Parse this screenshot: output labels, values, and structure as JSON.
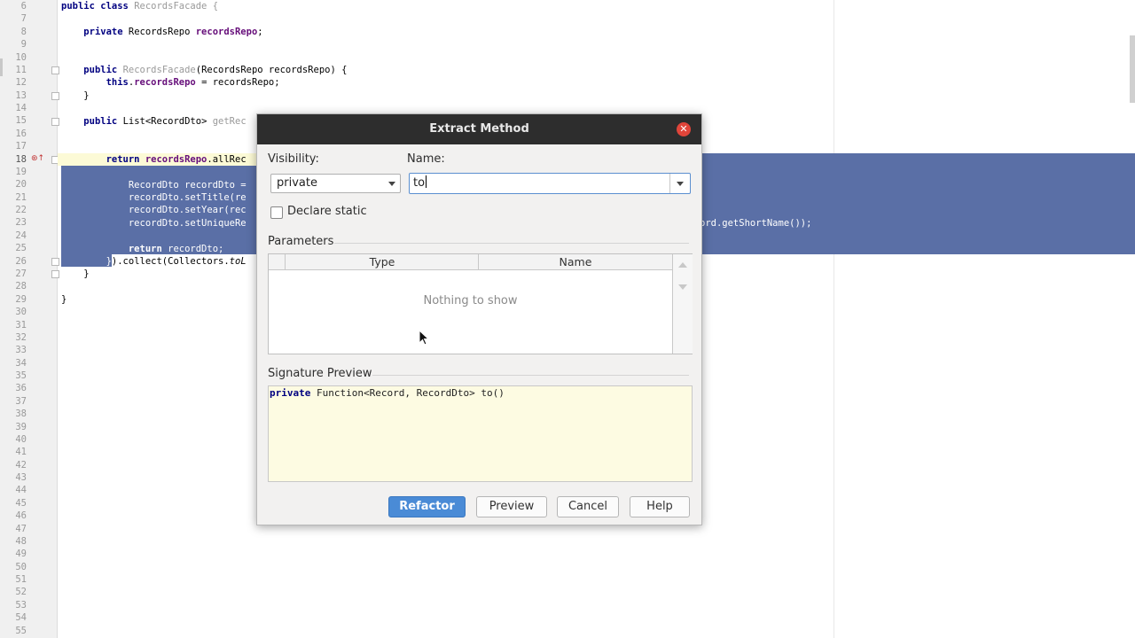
{
  "editor": {
    "line_numbers": [
      "6",
      "7",
      "8",
      "9",
      "10",
      "11",
      "12",
      "13",
      "14",
      "15",
      "16",
      "17",
      "18",
      "19",
      "20",
      "21",
      "22",
      "23",
      "24",
      "25",
      "26",
      "27",
      "28",
      "29",
      "30",
      "31",
      "32",
      "33",
      "34",
      "35",
      "36",
      "37",
      "38",
      "39",
      "40",
      "41",
      "42",
      "43",
      "44",
      "45",
      "46",
      "47",
      "48",
      "49",
      "50",
      "51",
      "52",
      "53",
      "54",
      "55"
    ],
    "l6_kw": "public class ",
    "l6_rest": "RecordsFacade {",
    "l8_kw": "private ",
    "l8_type": "RecordsRepo ",
    "l8_field": "recordsRepo",
    "l8_end": ";",
    "l11_kw": "public ",
    "l11_name": "RecordsFacade",
    "l11_rest": "(RecordsRepo recordsRepo) {",
    "l12_kw": "this",
    "l12_dot": ".",
    "l12_field": "recordsRepo",
    "l12_rest": " = recordsRepo;",
    "l13": "}",
    "l15_kw": "public ",
    "l15_type": "List<RecordDto> ",
    "l15_name": "getRec",
    "l18_kw": "return ",
    "l18_field": "recordsRepo",
    "l18_rest": ".allRec",
    "l20": "RecordDto recordDto =",
    "l21": "recordDto.setTitle(re",
    "l22": "recordDto.setYear(rec",
    "l23": "recordDto.setUniqueRe",
    "l23_right": "ord.getShortName());",
    "l25_kw": "return ",
    "l25_rest": "recordDto;",
    "l26_a": "}",
    "l26_b": ").collect(Collectors.",
    "l26_it": "toL",
    "l27": "}",
    "l29": "}"
  },
  "dialog": {
    "title": "Extract Method",
    "visibility_label": "Visibility:",
    "visibility_value": "private",
    "name_label": "Name:",
    "name_value": "to",
    "declare_static_label": "Declare static",
    "parameters_label": "Parameters",
    "columns": [
      "Type",
      "Name"
    ],
    "empty_text": "Nothing to show",
    "signature_label": "Signature Preview",
    "signature_kw": "private",
    "signature_rest": " Function<Record, RecordDto> to()",
    "buttons": {
      "refactor": "Refactor",
      "preview": "Preview",
      "cancel": "Cancel",
      "help": "Help"
    }
  },
  "colors": {
    "selection": "#5a6fa6",
    "primary_button": "#4a8bd6",
    "title_bar": "#2d2d2d",
    "close_button": "#e0453a",
    "signature_bg": "#fdfbe2"
  }
}
